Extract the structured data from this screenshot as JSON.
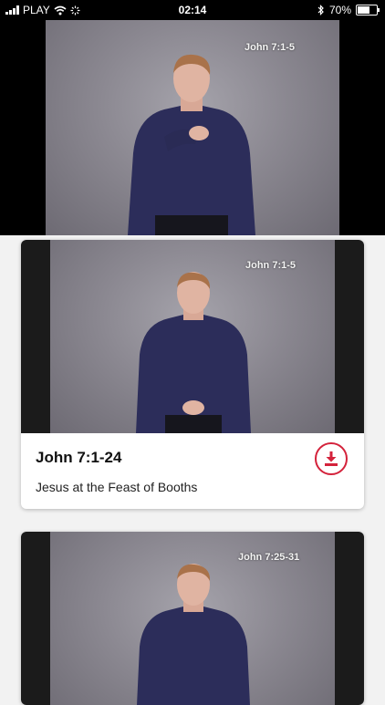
{
  "status_bar": {
    "carrier": "PLAY",
    "time": "02:14",
    "battery_percent": "70%",
    "battery_level": 0.7,
    "icons": [
      "signal-icon",
      "wifi-icon",
      "loading-icon",
      "bluetooth-icon",
      "battery-icon"
    ]
  },
  "player": {
    "verse_overlay": "John 7:1-5"
  },
  "videos": [
    {
      "verse_overlay": "John 7:1-5",
      "title": "John 7:1-24",
      "subtitle": "Jesus at the Feast of Booths",
      "action_icon": "download-icon"
    },
    {
      "verse_overlay": "John 7:25-31"
    }
  ],
  "colors": {
    "accent": "#d4223b",
    "background": "#f2f2f2",
    "status_bar": "#000000"
  }
}
